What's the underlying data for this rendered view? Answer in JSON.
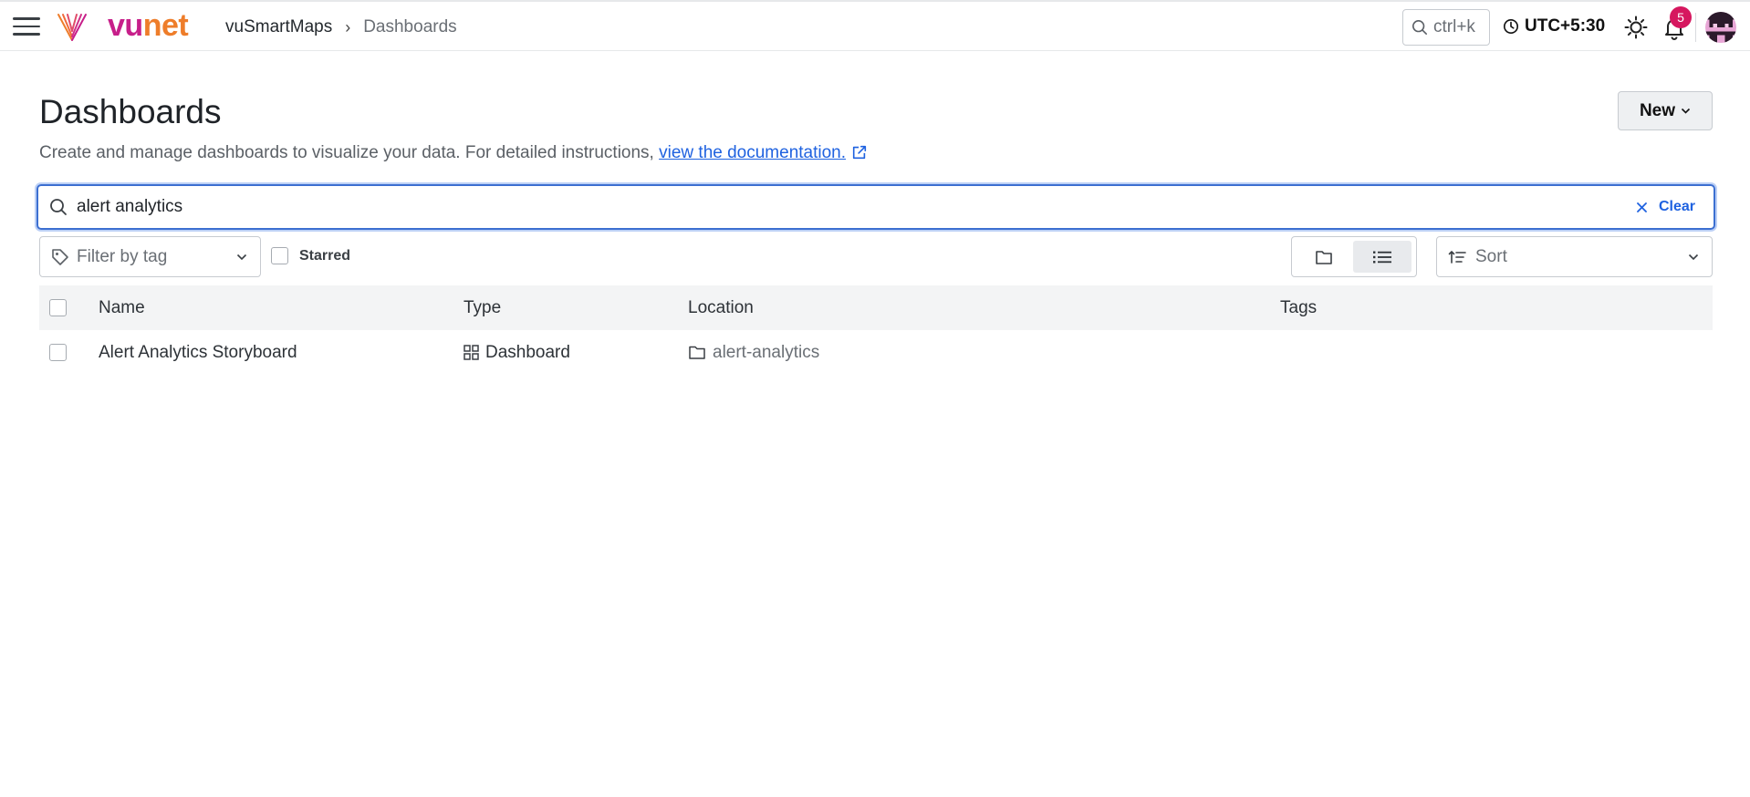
{
  "topbar": {
    "logo_part1": "vu",
    "logo_part2": "net",
    "breadcrumb": {
      "root": "vuSmartMaps",
      "current": "Dashboards"
    },
    "search_shortcut": "ctrl+k",
    "timezone": "UTC+5:30",
    "notification_count": "5"
  },
  "page": {
    "title": "Dashboards",
    "description": "Create and manage dashboards to visualize your data. For detailed instructions, ",
    "doc_link": "view the documentation.",
    "new_button": "New"
  },
  "search": {
    "value": "alert analytics",
    "clear_label": "Clear"
  },
  "filters": {
    "tag_placeholder": "Filter by tag",
    "starred_label": "Starred",
    "sort_label": "Sort"
  },
  "table": {
    "columns": {
      "name": "Name",
      "type": "Type",
      "location": "Location",
      "tags": "Tags"
    },
    "rows": [
      {
        "name": "Alert Analytics Storyboard",
        "type": "Dashboard",
        "location": "alert-analytics",
        "tags": ""
      }
    ]
  },
  "colors": {
    "accent": "#1f62e0",
    "focus_border": "#3c6fd1",
    "brand_pink": "#c71f8a",
    "brand_orange": "#ee7d2a",
    "badge": "#d6175f"
  }
}
